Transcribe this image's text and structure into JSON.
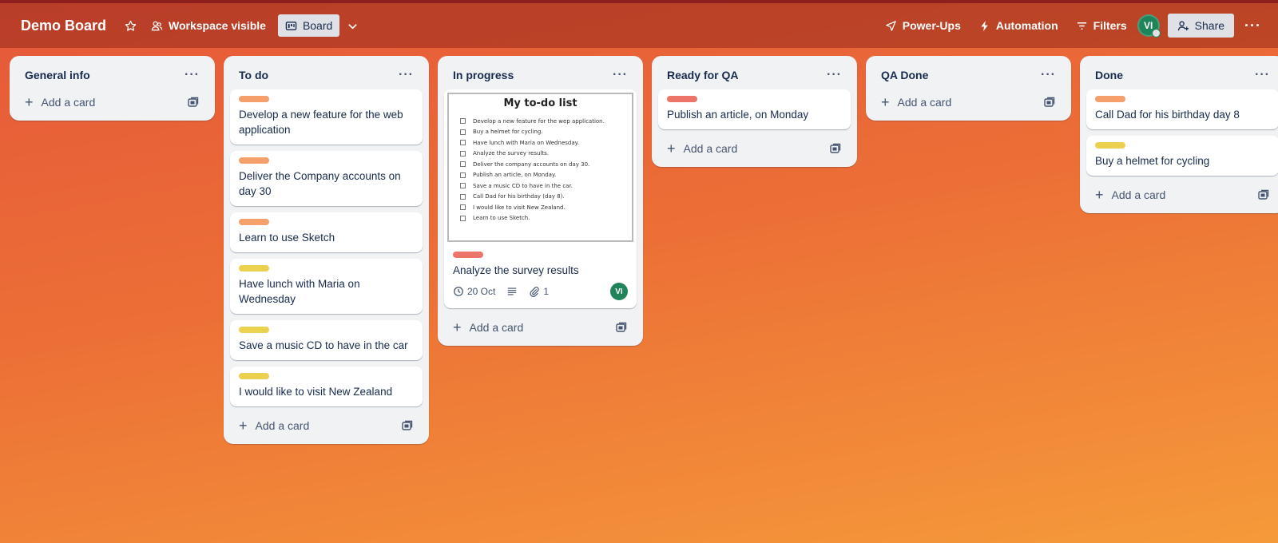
{
  "header": {
    "title": "Demo Board",
    "visibility": "Workspace visible",
    "view": "Board",
    "power_ups": "Power-Ups",
    "automation": "Automation",
    "filters": "Filters",
    "avatar_initials": "VI",
    "share": "Share"
  },
  "label_colors": {
    "orange": "#f5a06b",
    "yellow": "#ecd14f",
    "red": "#ec7468"
  },
  "lists": [
    {
      "title": "General info",
      "cards": [],
      "add_label": "Add a card"
    },
    {
      "title": "To do",
      "add_label": "Add a card",
      "cards": [
        {
          "label": "orange",
          "text": "Develop a new feature for the web application"
        },
        {
          "label": "orange",
          "text": "Deliver the Company accounts on day 30"
        },
        {
          "label": "orange",
          "text": "Learn to use Sketch"
        },
        {
          "label": "yellow",
          "text": "Have lunch with Maria on Wednesday"
        },
        {
          "label": "yellow",
          "text": "Save a music CD to have in the car"
        },
        {
          "label": "yellow",
          "text": "I would like to visit New Zealand"
        }
      ]
    },
    {
      "title": "In progress",
      "add_label": "Add a card",
      "cards": [
        {
          "label": "red",
          "text": "Analyze the survey results",
          "cover": {
            "title": "My to-do list",
            "items": [
              "Develop a new feature for the wep application.",
              "Buy a helmet for cycling.",
              "Have lunch with Maria on Wednesday.",
              "Analyze the survey results.",
              "Deliver the company accounts on day 30.",
              "Publish an article, on Monday.",
              "Save a music CD to have in the car.",
              "Call Dad for his birthday (day 8).",
              "I would like to visit New Zealand.",
              "Learn to use Sketch."
            ]
          },
          "due": "20 Oct",
          "attachments": "1",
          "member": "VI"
        }
      ]
    },
    {
      "title": "Ready for QA",
      "add_label": "Add a card",
      "cards": [
        {
          "label": "red",
          "text": "Publish an article, on Monday"
        }
      ]
    },
    {
      "title": "QA Done",
      "cards": [],
      "add_label": "Add a card"
    },
    {
      "title": "Done",
      "add_label": "Add a card",
      "cards": [
        {
          "label": "orange",
          "text": "Call Dad for his birthday day 8"
        },
        {
          "label": "yellow",
          "text": "Buy a helmet for cycling"
        }
      ]
    }
  ]
}
